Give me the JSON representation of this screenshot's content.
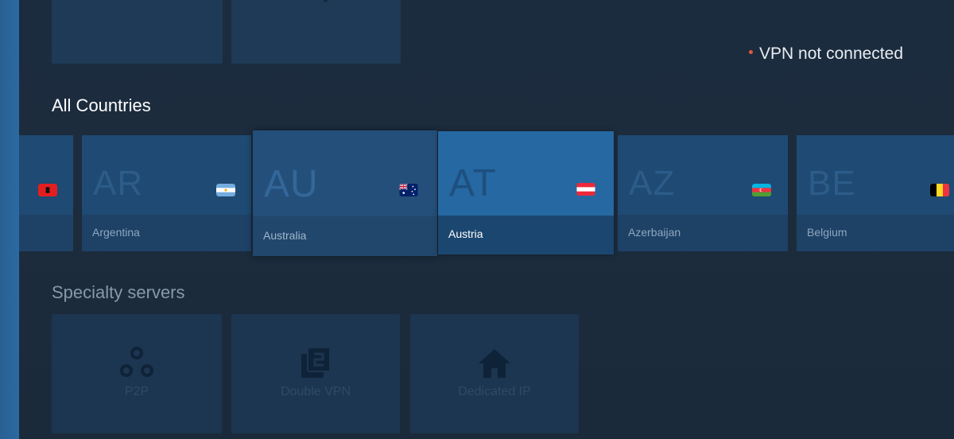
{
  "status": {
    "text": "VPN not connected",
    "dot_color": "#e2583e"
  },
  "sections": {
    "all_countries": "All Countries",
    "specialty": "Specialty servers"
  },
  "countries": [
    {
      "code": "",
      "name": "",
      "flag": "albania-flag"
    },
    {
      "code": "AR",
      "name": "Argentina",
      "flag": "argentina-flag"
    },
    {
      "code": "AU",
      "name": "Australia",
      "flag": "australia-flag"
    },
    {
      "code": "AT",
      "name": "Austria",
      "flag": "austria-flag"
    },
    {
      "code": "AZ",
      "name": "Azerbaijan",
      "flag": "azerbaijan-flag"
    },
    {
      "code": "BE",
      "name": "Belgium",
      "flag": "belgium-flag"
    }
  ],
  "specialty": [
    {
      "label": "P2P",
      "icon": "p2p-icon"
    },
    {
      "label": "Double VPN",
      "icon": "double-vpn-icon"
    },
    {
      "label": "Dedicated IP",
      "icon": "home-icon"
    }
  ],
  "colors": {
    "background": "#1b2c3e",
    "accent": "#2668a1",
    "side_strip": "#2b6aa3"
  }
}
